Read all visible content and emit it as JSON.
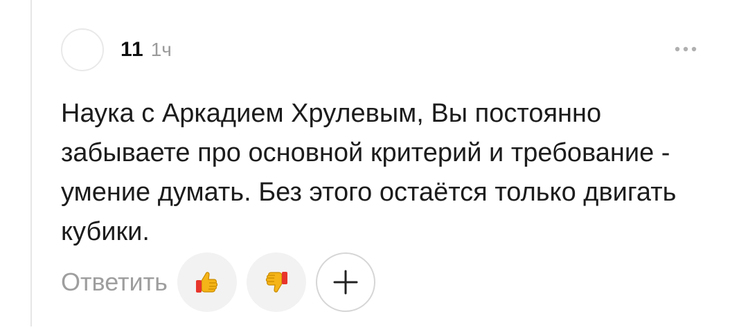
{
  "comment": {
    "author": "11",
    "time": "1ч",
    "text": "Наука с Аркадием Хрулевым, Вы постоянно забываете про основной критерий и требование - умение думать. Без этого остаётся только двигать кубики.",
    "actions": {
      "reply_label": "Ответить",
      "like_icon": "thumbs-up-icon",
      "dislike_icon": "thumbs-down-icon",
      "add_icon": "plus-icon"
    },
    "menu_icon": "more-dots-icon"
  },
  "colors": {
    "text": "#1c1c1c",
    "muted": "#9e9e9e",
    "button_bg": "#f2f2f2",
    "emoji_yellow": "#f5b417",
    "emoji_red": "#e8352c"
  }
}
